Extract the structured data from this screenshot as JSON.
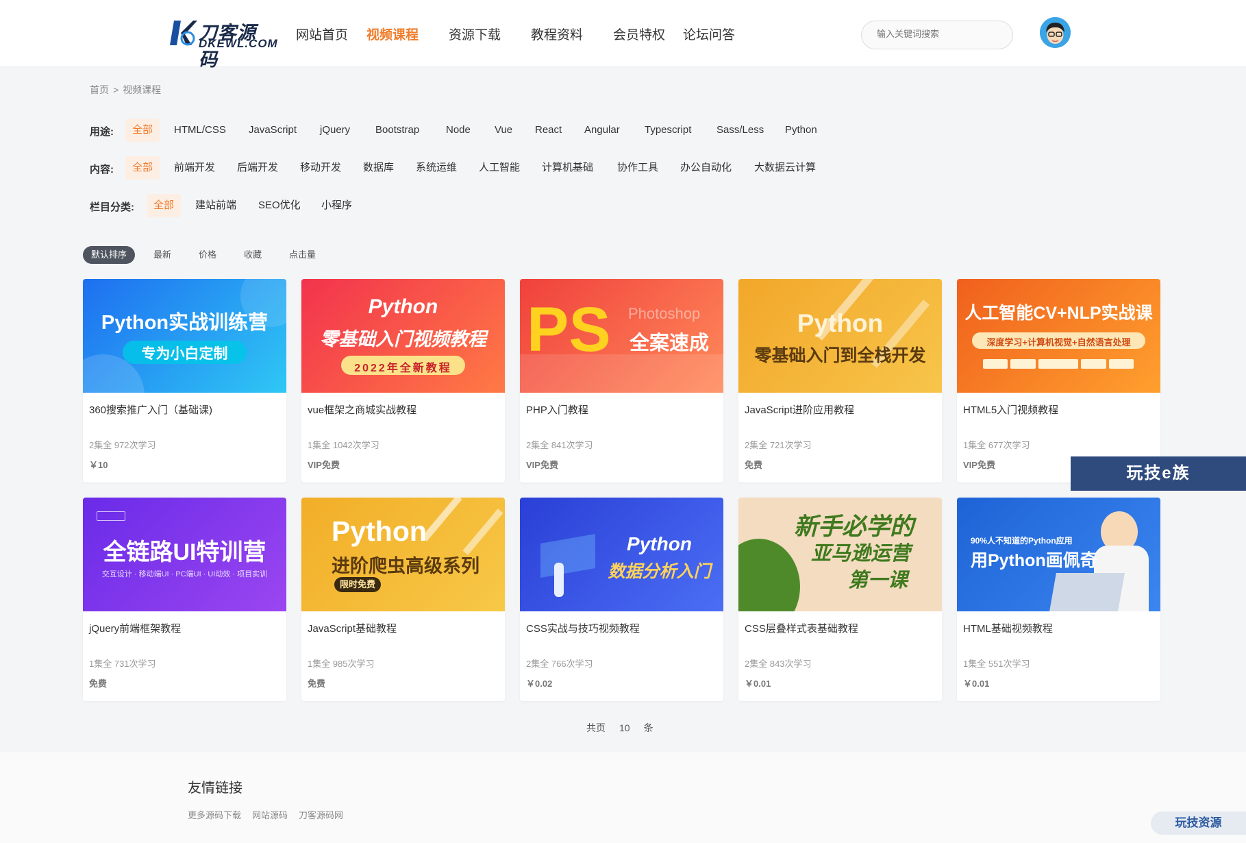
{
  "header": {
    "logo_cn": "刀客源码",
    "logo_en": "DKEWL.COM",
    "nav": [
      {
        "label": "网站首页",
        "active": false
      },
      {
        "label": "视频课程",
        "active": true
      },
      {
        "label": "资源下载",
        "active": false
      },
      {
        "label": "教程资料",
        "active": false
      },
      {
        "label": "会员特权",
        "active": false
      },
      {
        "label": "论坛问答",
        "active": false
      }
    ],
    "search_placeholder": "输入关键词搜索",
    "accent_color": "#f07c2a"
  },
  "breadcrumb": [
    "首页",
    ">",
    "视频课程"
  ],
  "filters": {
    "usage": {
      "label": "用途:",
      "items": [
        "全部",
        "HTML/CSS",
        "JavaScript",
        "jQuery",
        "Bootstrap",
        "Node",
        "Vue",
        "React",
        "Angular",
        "Typescript",
        "Sass/Less",
        "Python"
      ]
    },
    "content": {
      "label": "内容:",
      "items": [
        "全部",
        "前端开发",
        "后端开发",
        "移动开发",
        "数据库",
        "系统运维",
        "人工智能",
        "计算机基础",
        "协作工具",
        "办公自动化",
        "大数据云计算"
      ]
    },
    "column": {
      "label": "栏目分类:",
      "items": [
        "全部",
        "建站前端",
        "SEO优化",
        "小程序"
      ]
    }
  },
  "sort": [
    "默认排序",
    "最新",
    "价格",
    "收藏",
    "点击量"
  ],
  "courses": [
    {
      "title": "360搜索推广入门（基础课)",
      "meta": "2集全 972次学习",
      "price": "￥10",
      "thumb_title": "Python实战训练营",
      "thumb_sub": "专为小白定制",
      "bg": "#1e6ff0",
      "bg2": "#2fc7f5"
    },
    {
      "title": "vue框架之商城实战教程",
      "meta": "1集全 1042次学习",
      "price": "VIP免费",
      "thumb_title": "Python",
      "thumb_sub": "零基础入门视频教程",
      "thumb_sub2": "2022年全新教程",
      "bg": "#f2334d",
      "bg2": "#ff7a45"
    },
    {
      "title": "PHP入门教程",
      "meta": "2集全 841次学习",
      "price": "VIP免费",
      "thumb_title": "PS",
      "thumb_sub": "全案速成",
      "thumb_sub2": "Photoshop",
      "bg": "#f0413c",
      "bg2": "#ff8a5a"
    },
    {
      "title": "JavaScript进阶应用教程",
      "meta": "2集全 721次学习",
      "price": "免费",
      "thumb_title": "Python",
      "thumb_sub": "零基础入门到全栈开发",
      "bg": "#f2a72a",
      "bg2": "#f7c54a"
    },
    {
      "title": "HTML5入门视频教程",
      "meta": "1集全 677次学习",
      "price": "VIP免费",
      "thumb_title": "人工智能CV+NLP实战课",
      "thumb_sub": "深度学习+计算机视觉+自然语言处理",
      "bg": "#f0601d",
      "bg2": "#ffa02e"
    },
    {
      "title": "jQuery前端框架教程",
      "meta": "1集全 731次学习",
      "price": "免费",
      "thumb_title": "全链路UI特训营",
      "thumb_sub": "交互设计 · 移动端UI · PC端UI · UI动效 · 项目实训",
      "bg": "#6a2be8",
      "bg2": "#9b46f0"
    },
    {
      "title": "JavaScript基础教程",
      "meta": "1集全 985次学习",
      "price": "免费",
      "thumb_title": "Python",
      "thumb_sub": "进阶爬虫高级系列",
      "thumb_sub2": "限时免费",
      "bg": "#f2ae28",
      "bg2": "#f7c847"
    },
    {
      "title": "CSS实战与技巧视频教程",
      "meta": "2集全 766次学习",
      "price": "￥0.02",
      "thumb_title": "Python",
      "thumb_sub": "数据分析入门",
      "bg": "#2a3fd6",
      "bg2": "#4b6ef5"
    },
    {
      "title": "CSS层叠样式表基础教程",
      "meta": "2集全 843次学习",
      "price": "￥0.01",
      "thumb_title": "新手必学的",
      "thumb_sub": "亚马逊运营",
      "thumb_sub2": "第一课",
      "bg": "#f3dcc0",
      "bg2": "#5a8a2e"
    },
    {
      "title": "HTML基础视频教程",
      "meta": "1集全 551次学习",
      "price": "￥0.01",
      "thumb_title": "90%人不知道的Python应用",
      "thumb_sub": "用Python画佩奇",
      "bg": "#1e63d6",
      "bg2": "#3b86f0"
    }
  ],
  "pagination": {
    "prefix": "共页",
    "count": "10",
    "suffix": "条"
  },
  "footer": {
    "title": "友情链接",
    "links": [
      "更多源码下载",
      "网站源码",
      "刀客源码网"
    ]
  },
  "watermarks": [
    "玩技e族",
    "玩技资源"
  ]
}
